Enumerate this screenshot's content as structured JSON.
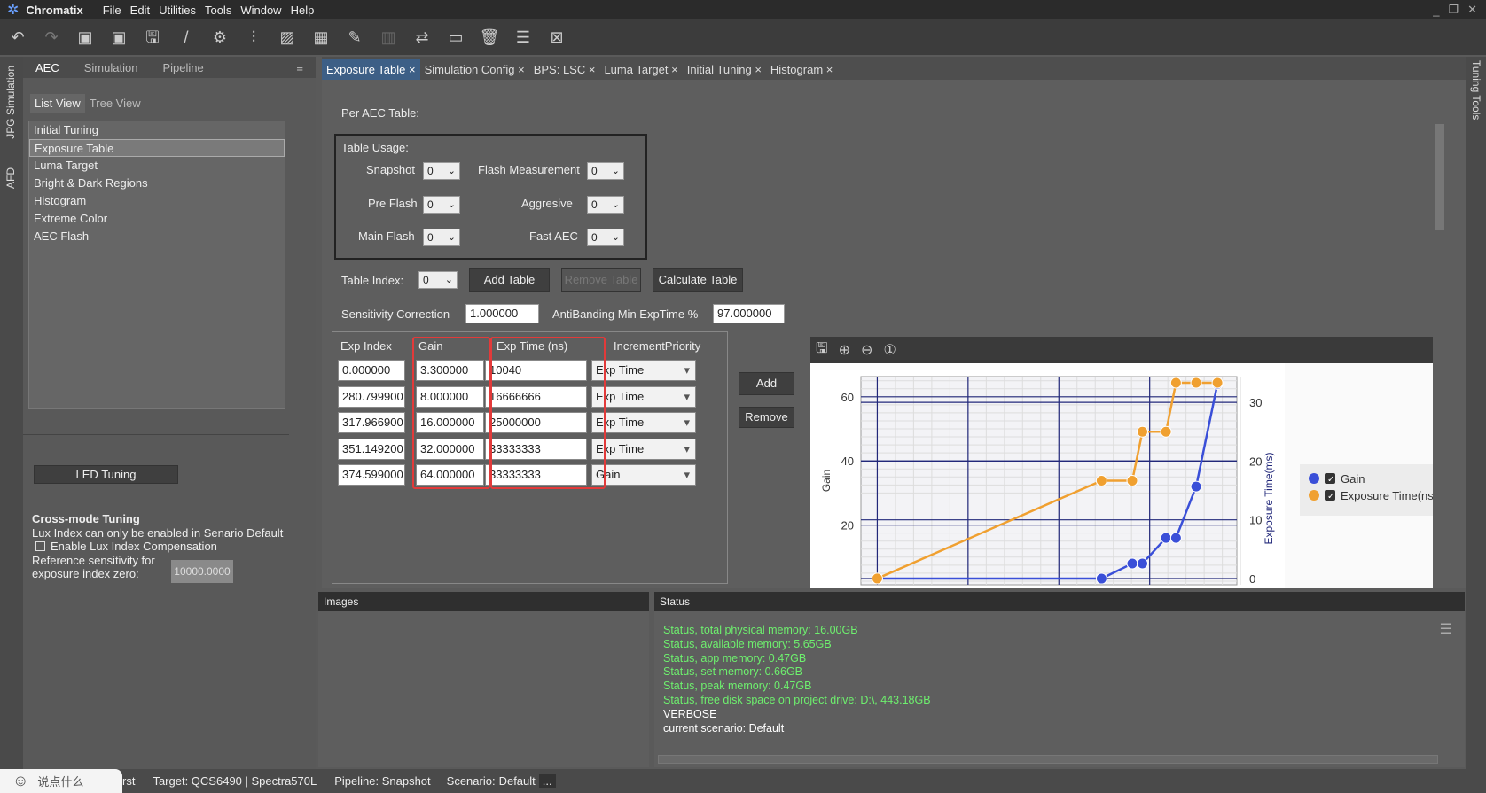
{
  "app": {
    "title": "Chromatix",
    "menu": [
      "File",
      "Edit",
      "Utilities",
      "Tools",
      "Window",
      "Help"
    ]
  },
  "side_strip": {
    "left": [
      "JPG Simulation",
      "AFD"
    ],
    "right": "Tuning Tools"
  },
  "left_panel": {
    "tabs": [
      "AEC",
      "Simulation",
      "Pipeline"
    ],
    "view_tabs": [
      "List View",
      "Tree View"
    ],
    "items": [
      "Initial Tuning",
      "Exposure Table",
      "Luma Target",
      "Bright & Dark Regions",
      "Histogram",
      "Extreme Color",
      "AEC Flash"
    ],
    "led_button": "LED Tuning",
    "cross_mode": {
      "title": "Cross-mode Tuning",
      "note": "Lux Index can only be enabled in Senario Default",
      "checkbox": "Enable Lux Index Compensation",
      "ref_label_1": "Reference sensitivity for",
      "ref_label_2": "exposure index zero:",
      "ref_value": "10000.0000"
    }
  },
  "doc_tabs": [
    "Exposure Table",
    "Simulation Config",
    "BPS: LSC",
    "Luma Target",
    "Initial Tuning",
    "Histogram"
  ],
  "main": {
    "per_aec": "Per AEC Table:",
    "table_usage": {
      "title": "Table Usage:",
      "snapshot": "Snapshot",
      "snapshot_val": "0",
      "flash_meas": "Flash Measurement",
      "flash_meas_val": "0",
      "pre_flash": "Pre Flash",
      "pre_flash_val": "0",
      "aggresive": "Aggresive",
      "aggresive_val": "0",
      "main_flash": "Main Flash",
      "main_flash_val": "0",
      "fast_aec": "Fast AEC",
      "fast_aec_val": "0"
    },
    "table_index_label": "Table Index:",
    "table_index": "0",
    "add_table": "Add Table",
    "remove_table": "Remove Table",
    "calculate_table": "Calculate Table",
    "sens_label": "Sensitivity Correction",
    "sens_value": "1.000000",
    "anti_label": "AntiBanding Min ExpTime %",
    "anti_value": "97.000000",
    "grid": {
      "headers": [
        "Exp Index",
        "Gain",
        "Exp Time (ns)",
        "IncrementPriority"
      ],
      "rows": [
        [
          "0.000000",
          "3.300000",
          "10040",
          "Exp Time"
        ],
        [
          "280.799900",
          "8.000000",
          "16666666",
          "Exp Time"
        ],
        [
          "317.966900",
          "16.000000",
          "25000000",
          "Exp Time"
        ],
        [
          "351.149200",
          "32.000000",
          "33333333",
          "Exp Time"
        ],
        [
          "374.599000",
          "64.000000",
          "33333333",
          "Gain"
        ]
      ]
    },
    "add": "Add",
    "remove": "Remove"
  },
  "chart_data": {
    "type": "line",
    "xlabel": "",
    "ylabel": "Gain",
    "y2label": "Exposure Time(ms)",
    "ylim": [
      0,
      66
    ],
    "y2lim": [
      0,
      34
    ],
    "xlim": [
      -18,
      396
    ],
    "yticks": [
      "60",
      "40",
      "20"
    ],
    "y2ticks": [
      "30",
      "20",
      "10",
      "0"
    ],
    "x": [
      0,
      247,
      280.8,
      292,
      317.97,
      329,
      351.15,
      374.6
    ],
    "series": [
      {
        "name": "Gain",
        "color": "#3a4fd8",
        "values": [
          3.3,
          3.3,
          8,
          8,
          16,
          16,
          32,
          64
        ]
      },
      {
        "name": "Exposure Time(ms)",
        "color": "#f0a030",
        "values": [
          0.01,
          16.67,
          16.67,
          25,
          25,
          33.33,
          33.33,
          33.33
        ]
      }
    ],
    "legend": [
      "Gain",
      "Exposure Time(ns"
    ],
    "legend_position": "right"
  },
  "images_panel": "Images",
  "status_panel": {
    "title": "Status",
    "lines": [
      "Status, total physical memory: 16.00GB",
      "Status, available memory: 5.65GB",
      "Status, app memory: 0.47GB",
      "Status, set memory: 0.66GB",
      "Status, peak memory: 0.47GB",
      "Status, free disk space on project drive: D:\\, 443.18GB"
    ],
    "white_lines": [
      "VERBOSE",
      "current scenario: Default"
    ]
  },
  "statusbar": {
    "chat": "说点什么",
    "frag": "rst",
    "target": "Target: QCS6490 | Spectra570L",
    "pipeline": "Pipeline: Snapshot",
    "scenario_label": "Scenario:",
    "scenario": "Default",
    "more": "..."
  }
}
